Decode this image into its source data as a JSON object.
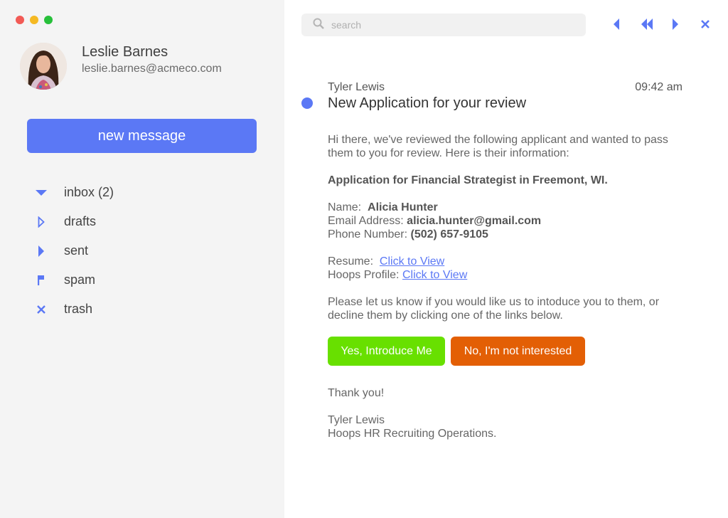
{
  "window": {
    "controls": [
      "close",
      "minimize",
      "maximize"
    ]
  },
  "user": {
    "name": "Leslie Barnes",
    "email": "leslie.barnes@acmeco.com"
  },
  "compose": {
    "label": "new message"
  },
  "folders": [
    {
      "label": "inbox (2)",
      "icon": "triangle-down-icon"
    },
    {
      "label": "drafts",
      "icon": "triangle-right-outline-icon"
    },
    {
      "label": "sent",
      "icon": "triangle-right-icon"
    },
    {
      "label": "spam",
      "icon": "flag-icon"
    },
    {
      "label": "trash",
      "icon": "x-icon"
    }
  ],
  "search": {
    "placeholder": "search"
  },
  "toolbar": {
    "icons": [
      "reply-icon",
      "reply-all-icon",
      "forward-icon",
      "close-icon"
    ]
  },
  "message": {
    "from": "Tyler Lewis",
    "time": "09:42 am",
    "subject": "New Application for your review",
    "intro": "Hi there, we've reviewed the following applicant and wanted to pass them to you for review.  Here is their information:",
    "position": "Application for Financial Strategist in Freemont, WI.",
    "name_label": "Name:",
    "name_value": "Alicia Hunter",
    "email_label": "Email Address:",
    "email_value": "alicia.hunter@gmail.com",
    "phone_label": "Phone Number:",
    "phone_value": "(502) 657-9105",
    "resume_label": "Resume:",
    "resume_link": "Click to View",
    "profile_label": "Hoops Profile:",
    "profile_link": "Click to View",
    "request": "Please let us know if you would like us to intoduce you to them, or decline them by clicking one of the links below.",
    "accept_label": "Yes, Introduce Me",
    "decline_label": "No, I'm not interested",
    "closing": "Thank you!",
    "signature_name": "Tyler Lewis",
    "signature_org": "Hoops HR Recruiting Operations."
  },
  "colors": {
    "accent": "#5b78f5",
    "accept": "#68e000",
    "decline": "#e35f05",
    "sidebar_bg": "#f4f4f4"
  }
}
